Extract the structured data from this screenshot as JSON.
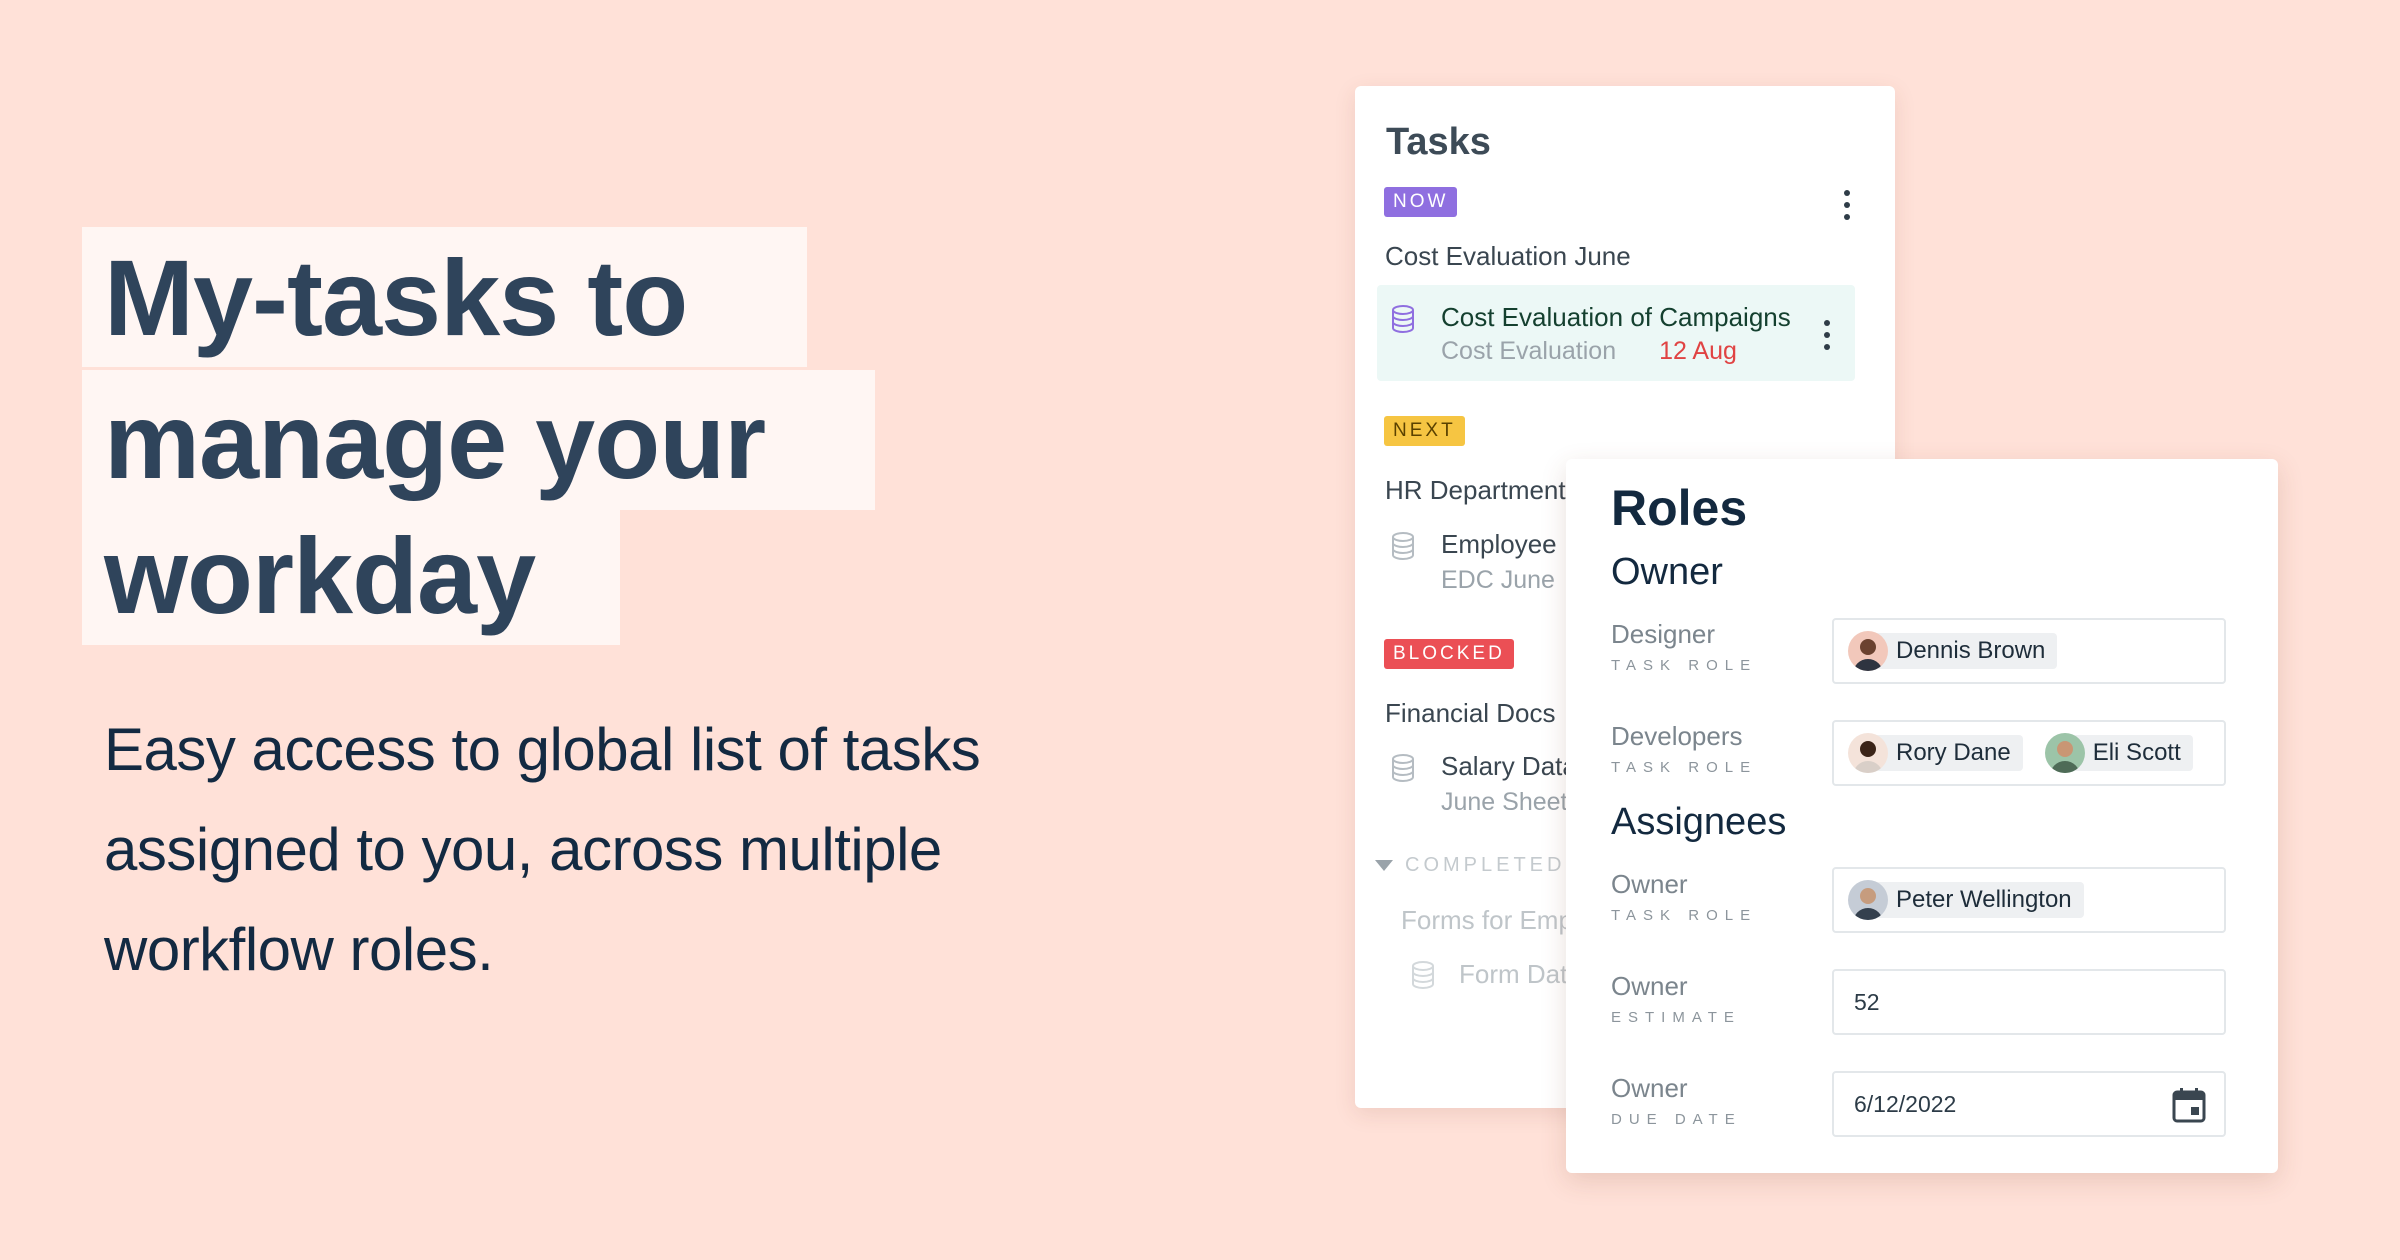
{
  "hero": {
    "headline_lines": [
      "My-tasks to",
      "manage your",
      "workday"
    ],
    "subtext_lines": [
      "Easy access to global list of tasks",
      "assigned to you, across multiple",
      "workflow roles."
    ]
  },
  "tasks_card": {
    "title": "Tasks",
    "groups": [
      {
        "status": "NOW",
        "status_color": "#8F6FE0",
        "title": "Cost Evaluation June",
        "task": {
          "name": "Cost Evaluation of Campaigns",
          "sub": "Cost Evaluation",
          "due": "12 Aug"
        }
      },
      {
        "status": "NEXT",
        "status_color": "#F6C542",
        "title": "HR Department",
        "task": {
          "name": "Employee D",
          "sub": "EDC June"
        }
      },
      {
        "status": "BLOCKED",
        "status_color": "#EB4F55",
        "title": "Financial Docs",
        "task": {
          "name": "Salary Data",
          "sub": "June Sheet"
        }
      }
    ],
    "completed": {
      "label": "COMPLETED",
      "title": "Forms for Emp",
      "task": {
        "name": "Form Dat"
      }
    }
  },
  "roles_card": {
    "title": "Roles",
    "owner_section": "Owner",
    "assignees_section": "Assignees",
    "fields": [
      {
        "label": "Designer",
        "caption": "TASK ROLE",
        "people": [
          "Dennis Brown"
        ]
      },
      {
        "label": "Developers",
        "caption": "TASK ROLE",
        "people": [
          "Rory Dane",
          "Eli Scott"
        ]
      },
      {
        "label": "Owner",
        "caption": "TASK ROLE",
        "people": [
          "Peter Wellington"
        ]
      },
      {
        "label": "Owner",
        "caption": "ESTIMATE",
        "value": "52"
      },
      {
        "label": "Owner",
        "caption": "DUE DATE",
        "value": "6/12/2022"
      }
    ]
  },
  "colors": {
    "background": "#FFE1D8",
    "headline_highlight": "#FFF6F3",
    "headline_text": "#2F445B",
    "active_task_bg": "#ECF8F6",
    "due_date": "#E04343"
  },
  "icons": [
    "database-icon",
    "more-vert-icon",
    "caret-down-icon",
    "calendar-icon",
    "avatar-icon"
  ]
}
